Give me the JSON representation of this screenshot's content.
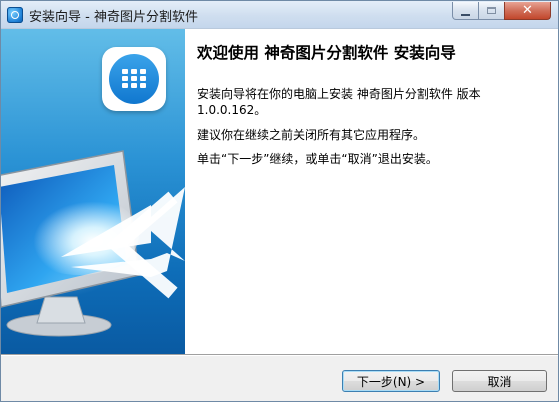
{
  "window": {
    "title": "安装向导 - 神奇图片分割软件",
    "controls": {
      "minimize_icon": "minimize-icon",
      "maximize_icon": "maximize-icon",
      "close_icon": "close-icon",
      "close_label": "✕"
    }
  },
  "banner": {
    "app_logo_icon": "grid-app-icon",
    "illustration_icon": "monitor-arrow-icon"
  },
  "content": {
    "heading": "欢迎使用 神奇图片分割软件 安装向导",
    "paragraph1": "安装向导将在你的电脑上安装 神奇图片分割软件 版本 1.0.0.162。",
    "paragraph2": "建议你在继续之前关闭所有其它应用程序。",
    "paragraph3": "单击“下一步”继续，或单击“取消”退出安装。"
  },
  "buttons": {
    "next_label": "下一步(N) >",
    "cancel_label": "取消"
  },
  "colors": {
    "banner_top": "#62bde8",
    "banner_bottom": "#0a5aa2",
    "close_button": "#c2472c",
    "titlebar": "#cfdeef"
  }
}
